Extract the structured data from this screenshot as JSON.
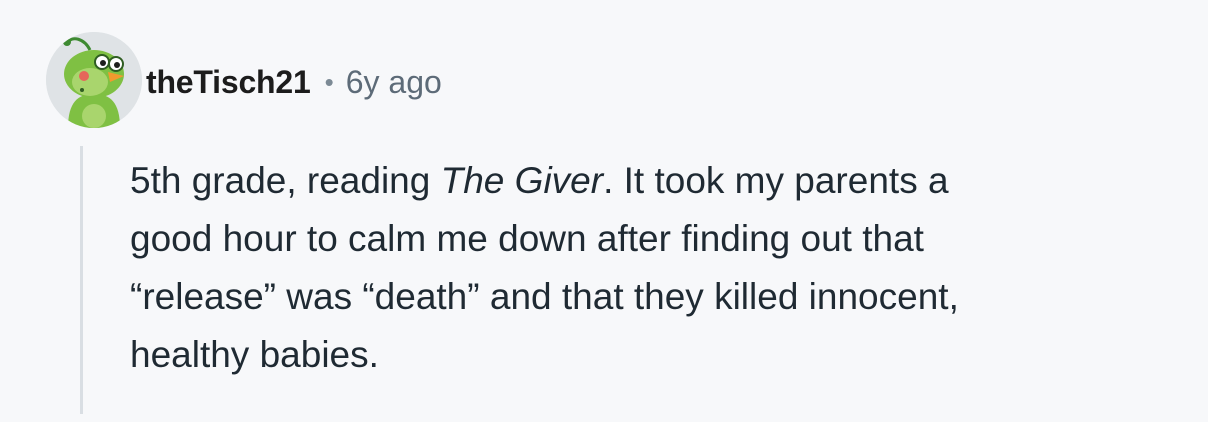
{
  "comment": {
    "author": "theTisch21",
    "separator": "•",
    "time_ago": "6y ago",
    "avatar_icon": "green-bird-avatar-icon",
    "body_lines": [
      [
        "5th grade, reading ",
        "The Giver",
        ". It took my parents a"
      ],
      "good hour to calm me down after finding out that",
      "“release” was “death” and that they killed innocent,",
      "healthy babies."
    ]
  },
  "colors": {
    "background": "#f7f8fa",
    "username": "#1c1c1c",
    "timestamp": "#5d6b78",
    "body": "#1f2a33",
    "thread_line": "#d9dee3",
    "avatar_green": "#7fc043"
  }
}
